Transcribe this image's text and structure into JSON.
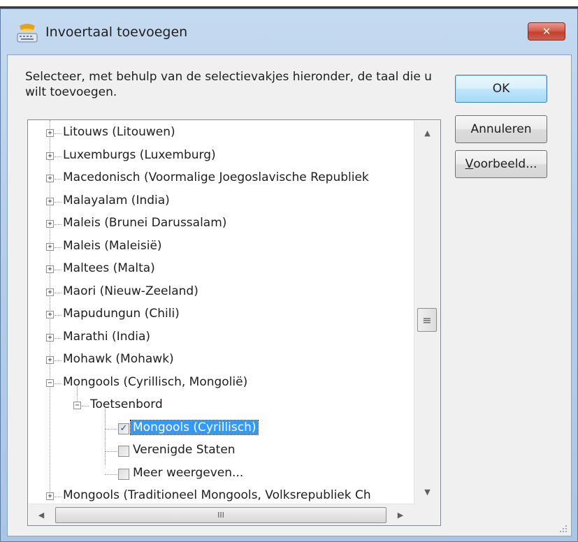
{
  "window": {
    "title": "Invoertaal toevoegen",
    "close_symbol": "✕"
  },
  "dialog": {
    "instruction": "Selecteer, met behulp van de selectievakjes hieronder, de taal die u wilt toevoegen.",
    "ok_label": "OK",
    "cancel_label": "Annuleren",
    "preview_label_accesskey": "V",
    "preview_label_rest": "oorbeeld..."
  },
  "tree": {
    "items": [
      {
        "label": "Litouws (Litouwen)",
        "expander": "+"
      },
      {
        "label": "Luxemburgs (Luxemburg)",
        "expander": "+"
      },
      {
        "label": "Macedonisch (Voormalige Joegoslavische Republiek",
        "expander": "+"
      },
      {
        "label": "Malayalam (India)",
        "expander": "+"
      },
      {
        "label": "Maleis (Brunei Darussalam)",
        "expander": "+"
      },
      {
        "label": "Maleis (Maleisië)",
        "expander": "+"
      },
      {
        "label": "Maltees (Malta)",
        "expander": "+"
      },
      {
        "label": "Maori (Nieuw-Zeeland)",
        "expander": "+"
      },
      {
        "label": "Mapudungun (Chili)",
        "expander": "+"
      },
      {
        "label": "Marathi (India)",
        "expander": "+"
      },
      {
        "label": "Mohawk (Mohawk)",
        "expander": "+"
      },
      {
        "label": "Mongools (Cyrillisch, Mongolië)",
        "expander": "−"
      }
    ],
    "sub_group": {
      "label": "Toetsenbord",
      "expander": "−"
    },
    "keyboards": [
      {
        "label": "Mongools (Cyrillisch)",
        "checked": true,
        "check_glyph": "✓"
      },
      {
        "label": "Verenigde Staten",
        "checked": false,
        "check_glyph": ""
      },
      {
        "label": "Meer weergeven...",
        "checked": false,
        "check_glyph": ""
      }
    ],
    "last_item": {
      "label": "Mongools (Traditioneel Mongools, Volksrepubliek Ch",
      "expander": "+"
    }
  },
  "scroll": {
    "up": "▲",
    "down": "▼",
    "left": "◀",
    "right": "▶",
    "v_grip": "≡",
    "h_grip": "III"
  },
  "colors": {
    "selection": "#3399ff",
    "window_frame": "#b6cfea",
    "close_button": "#c2402e"
  }
}
